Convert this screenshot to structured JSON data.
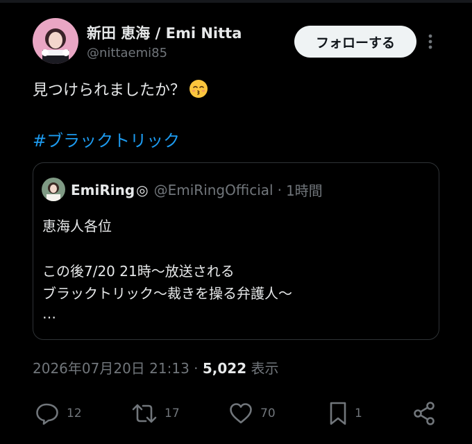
{
  "author": {
    "display_name": "新田 恵海 / Emi Nitta",
    "handle": "@nittaemi85"
  },
  "follow_label": "フォローする",
  "tweet_text": "見つけられましたか？",
  "tweet_emoji": "kissing-face-with-closed-eyes",
  "hashtag": "#ブラックトリック",
  "quote": {
    "name": "EmiRing",
    "name_mark": "◎",
    "handle": "@EmiRingOfficial",
    "separator": "·",
    "time": "1時間",
    "lines": [
      "恵海人各位",
      "この後7/20 21時〜放送される",
      "ブラックトリック〜裁きを操る弁護人〜",
      "…"
    ]
  },
  "meta": {
    "timestamp": "2026年07月20日 21:13",
    "separator": "·",
    "views": "5,022",
    "views_label": "表示"
  },
  "actions": {
    "reply": "12",
    "retweet": "17",
    "like": "70",
    "bookmark": "1"
  },
  "colors": {
    "background": "#000000",
    "text": "#e7e9ea",
    "secondary": "#71767b",
    "link": "#1d9bf0",
    "border": "#2f3336",
    "follow_button": "#eff3f4"
  }
}
